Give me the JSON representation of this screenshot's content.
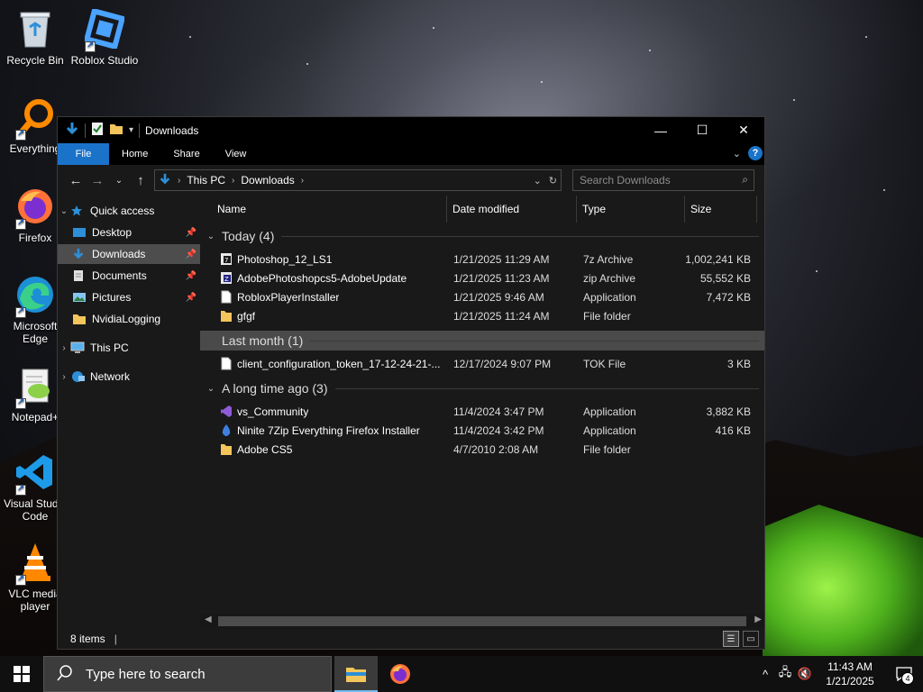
{
  "desktop": {
    "icons": [
      {
        "label": "Recycle Bin"
      },
      {
        "label": "Roblox Studio"
      },
      {
        "label": "Everything"
      },
      {
        "label": "Firefox"
      },
      {
        "label": "Microsoft Edge"
      },
      {
        "label": "Notepad+"
      },
      {
        "label": "Visual Studio Code"
      },
      {
        "label": "VLC media player"
      }
    ]
  },
  "window": {
    "title": "Downloads",
    "controls": {
      "minimize": "—",
      "maximize": "☐",
      "close": "✕"
    },
    "ribbon": {
      "tabs": [
        "File",
        "Home",
        "Share",
        "View"
      ],
      "help": "?"
    },
    "address": {
      "crumbs": [
        "This PC",
        "Downloads"
      ]
    },
    "search": {
      "placeholder": "Search Downloads"
    },
    "sidebar": {
      "items": [
        {
          "label": "Quick access"
        },
        {
          "label": "Desktop"
        },
        {
          "label": "Downloads"
        },
        {
          "label": "Documents"
        },
        {
          "label": "Pictures"
        },
        {
          "label": "NvidiaLogging"
        },
        {
          "label": "This PC"
        },
        {
          "label": "Network"
        }
      ]
    },
    "columns": [
      "Name",
      "Date modified",
      "Type",
      "Size"
    ],
    "groups": [
      {
        "title": "Today (4)",
        "files": [
          {
            "name": "Photoshop_12_LS1",
            "date": "1/21/2025 11:29 AM",
            "type": "7z Archive",
            "size": "1,002,241 KB",
            "icon": "archive-7z-icon"
          },
          {
            "name": "AdobePhotoshopcs5-AdobeUpdate",
            "date": "1/21/2025 11:23 AM",
            "type": "zip Archive",
            "size": "55,552 KB",
            "icon": "archive-zip-icon"
          },
          {
            "name": "RobloxPlayerInstaller",
            "date": "1/21/2025 9:46 AM",
            "type": "Application",
            "size": "7,472 KB",
            "icon": "application-icon"
          },
          {
            "name": "gfgf",
            "date": "1/21/2025 11:24 AM",
            "type": "File folder",
            "size": "",
            "icon": "folder-icon"
          }
        ]
      },
      {
        "title": "Last month (1)",
        "files": [
          {
            "name": "client_configuration_token_17-12-24-21-...",
            "date": "12/17/2024 9:07 PM",
            "type": "TOK File",
            "size": "3 KB",
            "icon": "file-icon"
          }
        ]
      },
      {
        "title": "A long time ago (3)",
        "files": [
          {
            "name": "vs_Community",
            "date": "11/4/2024 3:47 PM",
            "type": "Application",
            "size": "3,882 KB",
            "icon": "visual-studio-icon"
          },
          {
            "name": "Ninite 7Zip Everything Firefox Installer",
            "date": "11/4/2024 3:42 PM",
            "type": "Application",
            "size": "416 KB",
            "icon": "ninite-icon"
          },
          {
            "name": "Adobe CS5",
            "date": "4/7/2010 2:08 AM",
            "type": "File folder",
            "size": "",
            "icon": "folder-icon"
          }
        ]
      }
    ],
    "status": {
      "count": "8 items"
    }
  },
  "taskbar": {
    "search_placeholder": "Type here to search",
    "time": "11:43 AM",
    "date": "1/21/2025",
    "notification_count": "4"
  },
  "colors": {
    "accent": "#1a73c9",
    "window_bg": "#191919",
    "titlebar_bg": "#000000",
    "selection": "#4d4d4d",
    "folder": "#f4c55a"
  }
}
